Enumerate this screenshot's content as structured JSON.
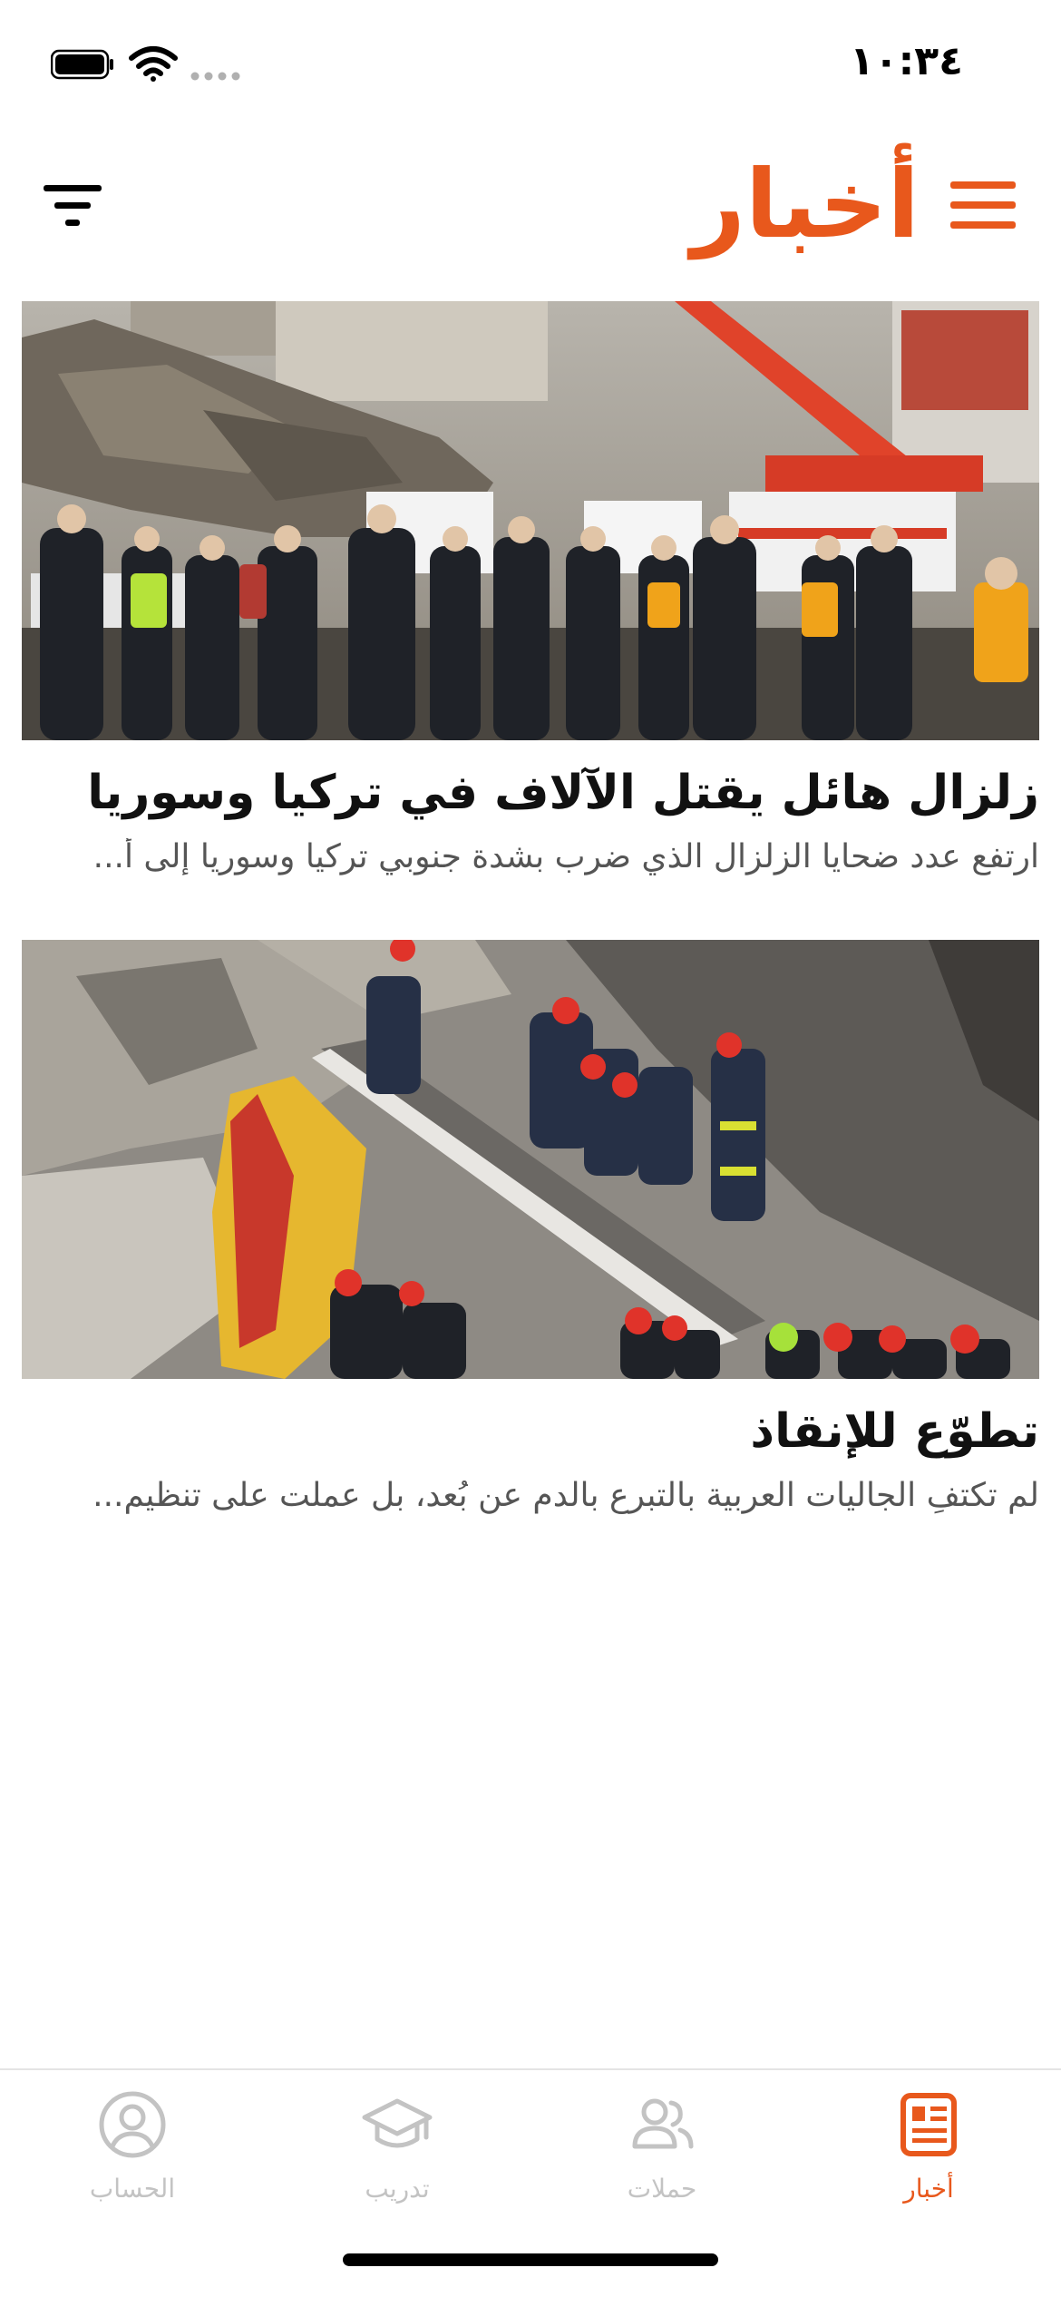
{
  "status_bar": {
    "time": "١٠:٣٤"
  },
  "header": {
    "title": "أخبار",
    "menu_icon": "hamburger-menu-icon",
    "filter_icon": "filter-icon"
  },
  "colors": {
    "accent": "#e8581c",
    "inactive_tab": "#c3c3c3",
    "title_text": "#111111",
    "summary_text": "#555555"
  },
  "articles": [
    {
      "title": "زلزال هائل يقتل الآلاف في تركيا وسوريا",
      "summary": "ارتفع عدد ضحايا الزلزال الذي ضرب بشدة جنوبي تركيا وسوريا إلى أ...",
      "image": "earthquake-rescue-scene-photo"
    },
    {
      "title": "تطوّع للإنقاذ",
      "summary": "لم تكتفِ الجاليات العربية بالتبرع بالدم عن بُعد، بل عملت على تنظيم...",
      "image": "rescuers-in-rubble-photo"
    }
  ],
  "tab_bar": {
    "tabs": [
      {
        "label": "أخبار",
        "icon": "newspaper-icon",
        "active": true
      },
      {
        "label": "حملات",
        "icon": "people-icon",
        "active": false
      },
      {
        "label": "تدريب",
        "icon": "graduation-cap-icon",
        "active": false
      },
      {
        "label": "الحساب",
        "icon": "account-circle-icon",
        "active": false
      }
    ]
  }
}
